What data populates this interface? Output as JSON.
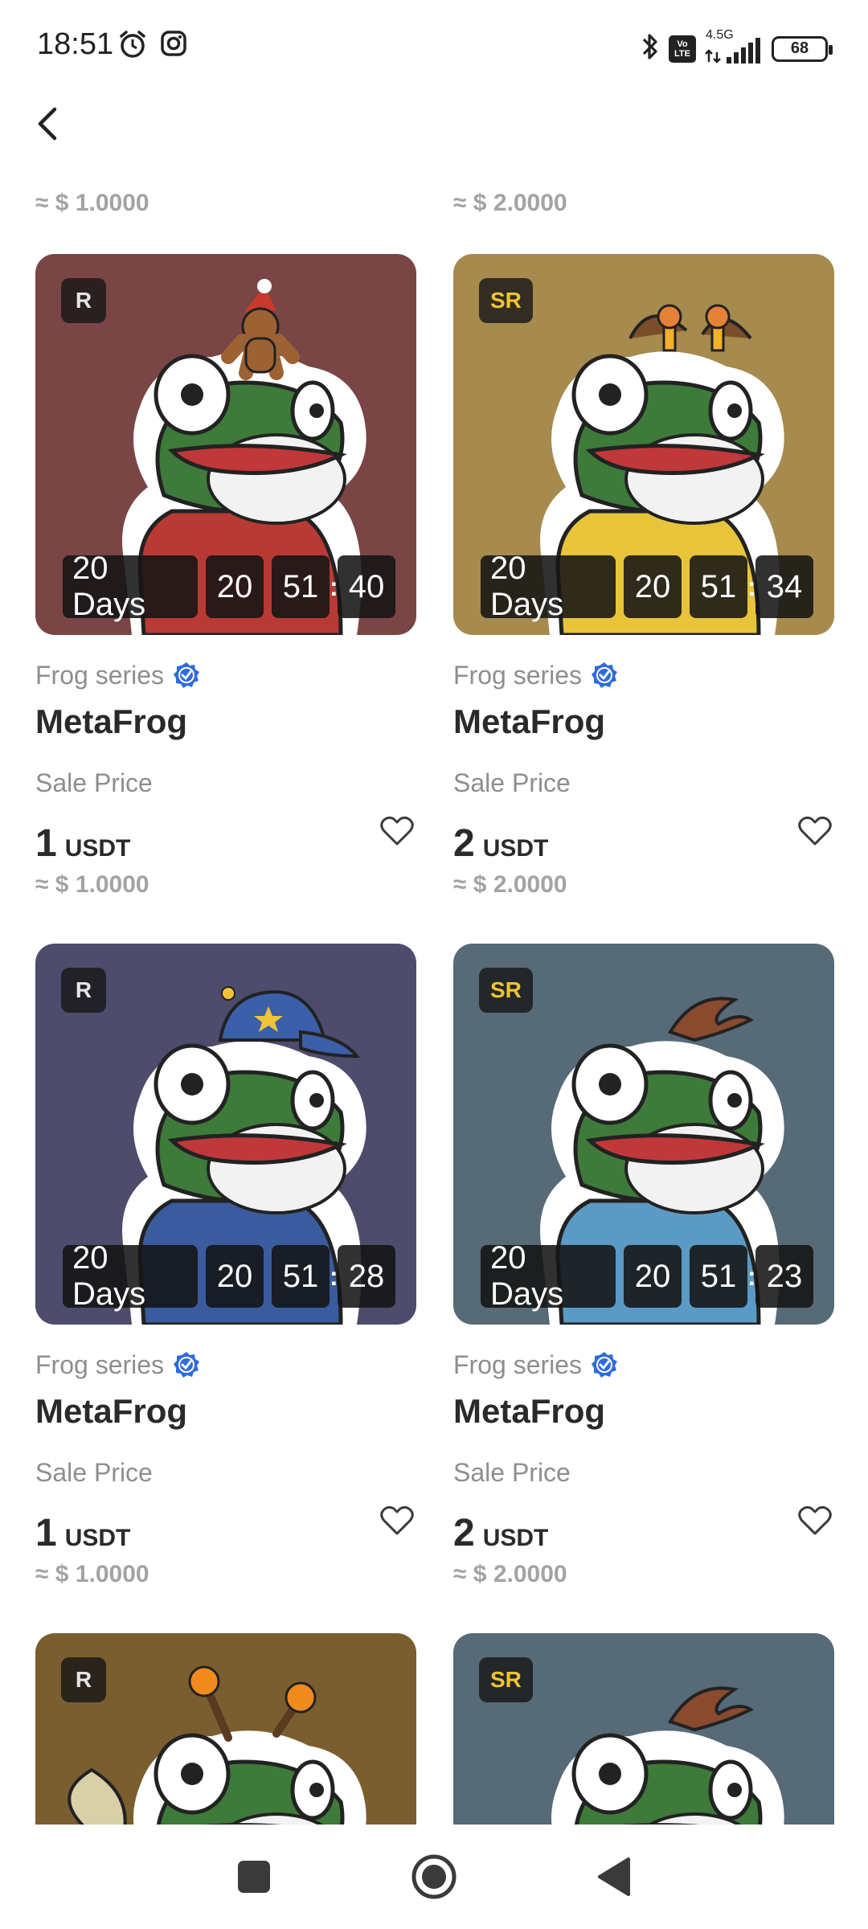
{
  "status_bar": {
    "time": "18:51",
    "network": "4.5G",
    "volte": "Vo LTE",
    "battery": "68"
  },
  "header": {
    "back_icon": "chevron-left-icon"
  },
  "top_partial": [
    {
      "usd": "≈ $ 1.0000"
    },
    {
      "usd": "≈ $ 2.0000"
    }
  ],
  "labels": {
    "series": "Frog series",
    "sale_price": "Sale Price",
    "unit": "USDT"
  },
  "colors": {
    "verified": "#2f6bdc",
    "rarity_sr": "#f1c431",
    "rarity_r": "#e5e5e5"
  },
  "cards": [
    {
      "rarity": "R",
      "bg": "#7a4545",
      "outfit": "#b93a34",
      "accessory": "gingerbread",
      "days": "20 Days",
      "hours": "20",
      "minutes": "51",
      "seconds": "40",
      "series": "Frog series",
      "title": "MetaFrog",
      "price": "1",
      "unit": "USDT",
      "usd": "≈ $ 1.0000"
    },
    {
      "rarity": "SR",
      "bg": "#a68a4e",
      "outfit": "#e8c43a",
      "accessory": "giraffe",
      "days": "20 Days",
      "hours": "20",
      "minutes": "51",
      "seconds": "34",
      "series": "Frog series",
      "title": "MetaFrog",
      "price": "2",
      "unit": "USDT",
      "usd": "≈ $ 2.0000"
    },
    {
      "rarity": "R",
      "bg": "#4d4c6c",
      "outfit": "#3a5c9e",
      "accessory": "cap",
      "days": "20 Days",
      "hours": "20",
      "minutes": "51",
      "seconds": "28",
      "series": "Frog series",
      "title": "MetaFrog",
      "price": "1",
      "unit": "USDT",
      "usd": "≈ $ 1.0000"
    },
    {
      "rarity": "SR",
      "bg": "#566a77",
      "outfit": "#5b9ac4",
      "accessory": "hair",
      "days": "20 Days",
      "hours": "20",
      "minutes": "51",
      "seconds": "23",
      "series": "Frog series",
      "title": "MetaFrog",
      "price": "2",
      "unit": "USDT",
      "usd": "≈ $ 2.0000"
    },
    {
      "rarity": "R",
      "bg": "#7a5e30",
      "outfit": "#c6a664",
      "accessory": "antenna",
      "days": "",
      "hours": "",
      "minutes": "",
      "seconds": "",
      "series": "",
      "title": "",
      "price": "",
      "unit": "",
      "usd": ""
    },
    {
      "rarity": "SR",
      "bg": "#566a77",
      "outfit": "#5b9ac4",
      "accessory": "hair",
      "days": "",
      "hours": "",
      "minutes": "",
      "seconds": "",
      "series": "",
      "title": "",
      "price": "",
      "unit": "",
      "usd": ""
    }
  ],
  "nav": {
    "recents_icon": "square-icon",
    "home_icon": "circle-home-icon",
    "back_icon": "triangle-back-icon"
  }
}
